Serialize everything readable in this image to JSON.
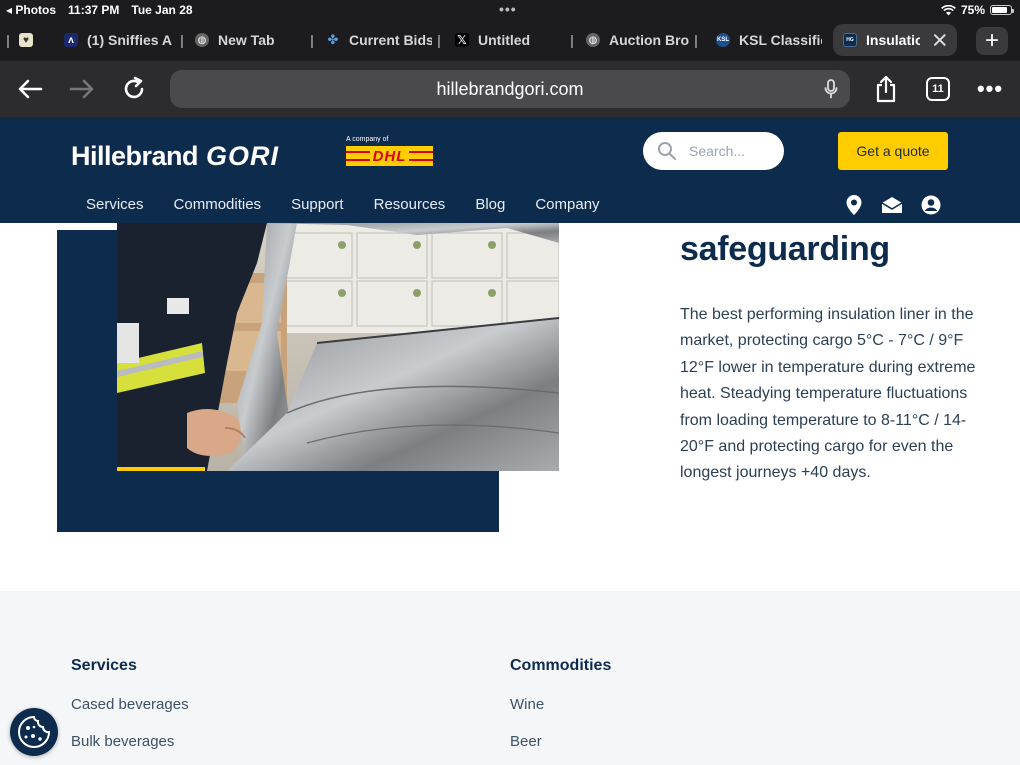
{
  "statusbar": {
    "back_app": "◂ Photos",
    "time": "11:37 PM",
    "date": "Tue Jan 28",
    "battery": "75%",
    "battery_level": 0.75
  },
  "tabs": [
    {
      "label": "(1) Sniffies A",
      "icon": "sniffies-icon",
      "color": "#1a2a6c"
    },
    {
      "label": "New Tab",
      "icon": "globe-icon",
      "color": "#555"
    },
    {
      "label": "Current Bids",
      "icon": "bids-icon",
      "color": "#2a6fb0"
    },
    {
      "label": "Untitled",
      "icon": "x-logo-icon",
      "color": "#000"
    },
    {
      "label": "Auction Brok",
      "icon": "globe-icon",
      "color": "#555"
    },
    {
      "label": "KSL Classifie",
      "icon": "ksl-icon",
      "color": "#1d4f91"
    },
    {
      "label": "Insulatio",
      "icon": "hillebrand-favicon",
      "color": "#0d2b4d",
      "active": true
    }
  ],
  "toolbar": {
    "url": "hillebrandgori.com",
    "tab_count": "11"
  },
  "site": {
    "logo_main": "Hillebrand",
    "logo_gori": "GORI",
    "company_of": "A company of",
    "dhl": "DHL",
    "search_placeholder": "Search...",
    "quote_label": "Get a quote",
    "nav": [
      "Services",
      "Commodities",
      "Support",
      "Resources",
      "Blog",
      "Company"
    ]
  },
  "content": {
    "heading": "safeguarding",
    "body": "The best performing insulation liner in the market, protecting cargo 5°C - 7°C / 9°F 12°F lower in temperature during extreme heat.  Steadying temperature fluctuations from loading temperature to 8-11°C / 14-20°F and protecting cargo for even the longest journeys +40 days."
  },
  "footer": {
    "services_title": "Services",
    "services_links": [
      "Cased beverages",
      "Bulk beverages"
    ],
    "commodities_title": "Commodities",
    "commodities_links": [
      "Wine",
      "Beer"
    ]
  },
  "colors": {
    "navy": "#0d2b4d",
    "yellow": "#ffcc00",
    "dhl_red": "#d40511"
  }
}
